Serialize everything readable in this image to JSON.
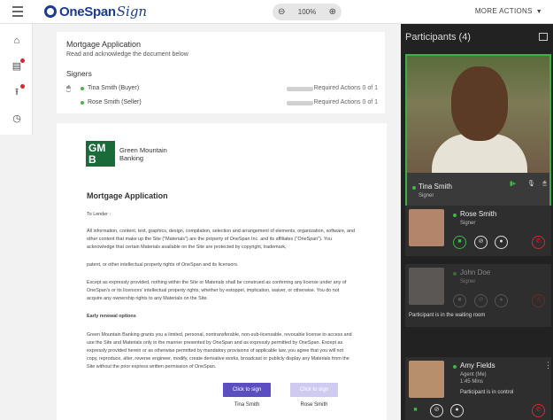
{
  "header": {
    "logo_text": "OneSpan",
    "logo_script": "Sign",
    "zoom_level": "100%",
    "zoom_out_icon": "zoom-out-icon",
    "zoom_in_icon": "zoom-in-icon",
    "more_actions": "MORE ACTIONS",
    "brand_color": "#1e3c8a"
  },
  "leftnav": {
    "items": [
      {
        "icon": "home-icon"
      },
      {
        "icon": "document-icon",
        "badge": true
      },
      {
        "icon": "upload-icon",
        "badge": true
      },
      {
        "icon": "clock-icon"
      }
    ]
  },
  "summary": {
    "title": "Mortgage Application",
    "subtitle": "Read and acknowledge the document below",
    "signers_heading": "Signers",
    "signers": [
      {
        "name": "Tina Smith (Buyer)",
        "status": "Required Actions 0 of 1",
        "progress": 0
      },
      {
        "name": "Rose Smith (Seller)",
        "status": "Required Actions 0 of 1",
        "progress": 0
      }
    ]
  },
  "document": {
    "logo_letters": "GM B",
    "company_line1": "Green Mountain",
    "company_line2": "Banking",
    "title": "Mortgage Application",
    "to": "To Lender :",
    "p1": "All information, content, text, graphics, design, compilation, selection and arrangement of elements, organization, software, and other content that make up the Site (\"Materials\") are the property of OneSpan Inc. and its affiliates (\"OneSpan\"). You acknowledge that certain Materials available on the Site are protected by copyright, trademark,",
    "p2": "patent, or other intellectual property rights of OneSpan and its licensors.",
    "p3": "Except as expressly provided, nothing within the Site or Materials shall be construed as conferring any license under any of OneSpan's or its licensors' intellectual property rights, whether by estoppel, implication, waiver, or otherwise. You do not acquire any ownership rights to any Materials on the Site.",
    "p4_heading": "Early renewal options",
    "p5": "Green Mountain Banking grants you a limited, personal, nontransferable, non-sub-licensable, revocable license to access and use the Site and Materials only in the manner presented by OneSpan and as expressly permitted by OneSpan. Except as expressly provided herein or as otherwise permitted by mandatory provisions of applicable law, you agree that you will not copy, reproduce, alter, reverse engineer, modify, create derivative works, broadcast or publicly display any Materials from the Site without the prior express written permission of OneSpan.",
    "sign_button_1": "Click to sign",
    "sign_button_2": "Click to sign",
    "signer_1": "Tina Smith",
    "signer_2": "Rose Smith"
  },
  "participants": {
    "title": "Participants (4)",
    "list": [
      {
        "name": "Tina Smith",
        "role": "Signer"
      },
      {
        "name": "Rose Smith",
        "role": "Signer"
      },
      {
        "name": "John Doe",
        "role": "Signer",
        "note": "Participant is in the waiting room"
      },
      {
        "name": "Amy Fields",
        "role": "Agent (Me)",
        "duration": "1:45 Mins",
        "note": "Participant is in control"
      }
    ]
  },
  "colors": {
    "active_green": "#41b649",
    "alert_red": "#d8262f",
    "sign_purple": "#5b4ec1"
  }
}
